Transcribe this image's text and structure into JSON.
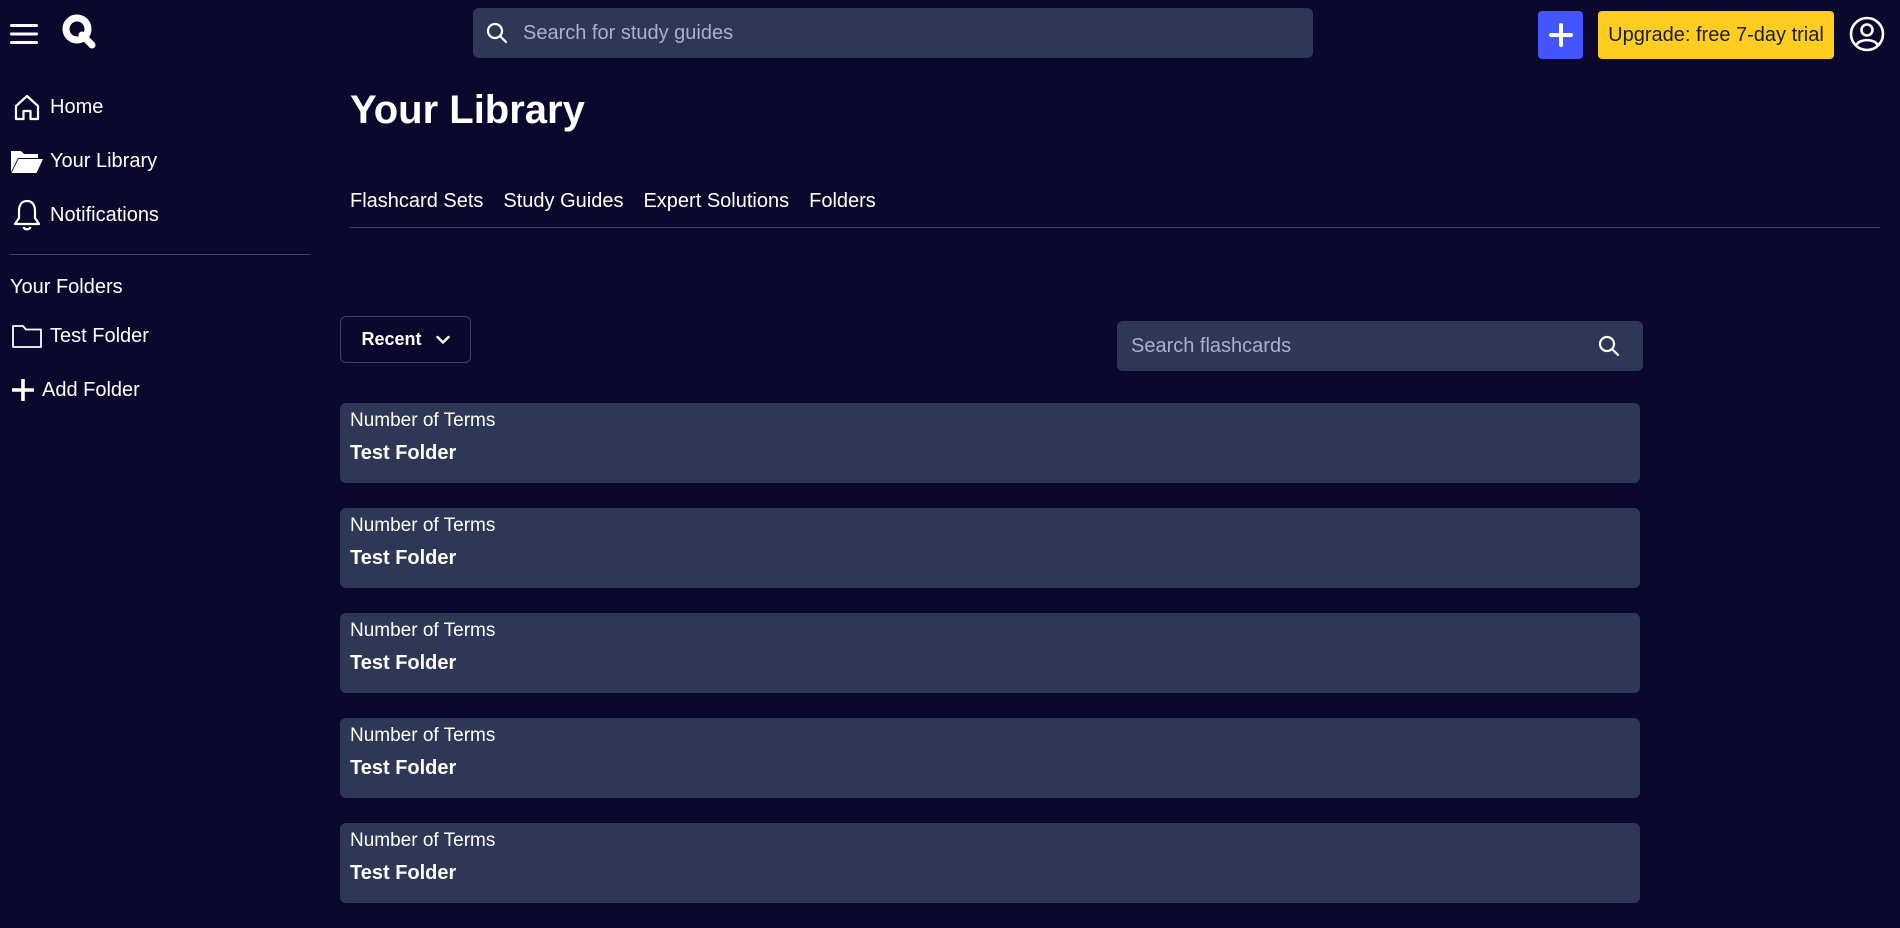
{
  "header": {
    "search_placeholder": "Search for study guides",
    "upgrade_label": "Upgrade: free 7-day trial"
  },
  "sidebar": {
    "nav": [
      {
        "label": "Home",
        "icon": "home-icon"
      },
      {
        "label": "Your Library",
        "icon": "folder-open-icon"
      },
      {
        "label": "Notifications",
        "icon": "bell-icon"
      }
    ],
    "folders_heading": "Your Folders",
    "folders": [
      {
        "label": "Test Folder",
        "icon": "folder-icon"
      }
    ],
    "add_folder_label": "Add Folder"
  },
  "main": {
    "title": "Your Library",
    "tabs": [
      {
        "label": "Flashcard Sets"
      },
      {
        "label": "Study Guides"
      },
      {
        "label": "Expert Solutions"
      },
      {
        "label": "Folders"
      }
    ],
    "sort_label": "Recent",
    "search_placeholder": "Search flashcards",
    "cards": [
      {
        "count_label": "Number of Terms",
        "name": "Test Folder"
      },
      {
        "count_label": "Number of Terms",
        "name": "Test Folder"
      },
      {
        "count_label": "Number of Terms",
        "name": "Test Folder"
      },
      {
        "count_label": "Number of Terms",
        "name": "Test Folder"
      },
      {
        "count_label": "Number of Terms",
        "name": "Test Folder"
      }
    ]
  },
  "colors": {
    "background": "#0a092d",
    "surface": "#2e3856",
    "accent": "#4255ff",
    "upgrade": "#ffcd1f"
  }
}
